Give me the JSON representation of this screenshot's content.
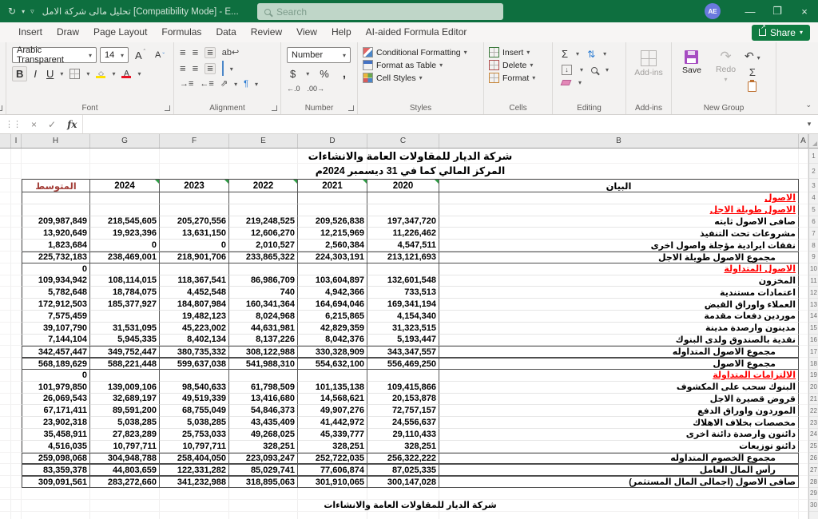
{
  "window": {
    "title": "تحليل مالى شركة الامل  [Compatibility Mode] - E...",
    "search_placeholder": "Search",
    "avatar": "AE",
    "minimize": "—",
    "restore": "❐",
    "close": "×"
  },
  "menubar": {
    "tabs": [
      "Insert",
      "Draw",
      "Page Layout",
      "Formulas",
      "Data",
      "Review",
      "View",
      "Help",
      "AI-aided Formula Editor"
    ],
    "share_label": "Share"
  },
  "ribbon": {
    "font_group": {
      "label": "Font",
      "font_name": "Arabic Transparent",
      "font_size": "14",
      "bold": "B",
      "italic": "I",
      "underline": "U"
    },
    "alignment_group": {
      "label": "Alignment"
    },
    "number_group": {
      "label": "Number",
      "format": "Number",
      "currency": "$",
      "percent": "%",
      "comma": ",",
      "inc_decimal": "←.0",
      "dec_decimal": ".00→"
    },
    "styles_group": {
      "label": "Styles",
      "items": [
        "Conditional Formatting",
        "Format as Table",
        "Cell Styles"
      ]
    },
    "cells_group": {
      "label": "Cells",
      "items": [
        "Insert",
        "Delete",
        "Format"
      ]
    },
    "editing_group": {
      "label": "Editing"
    },
    "addins_group": {
      "label": "Add-ins",
      "button": "Add-ins"
    },
    "new_group": {
      "label": "New Group",
      "save": "Save",
      "redo": "Redo"
    }
  },
  "formula_bar": {
    "cancel": "×",
    "enter": "✓",
    "fx": "fx",
    "value": ""
  },
  "sheet": {
    "columns": [
      "",
      "I",
      "H",
      "G",
      "F",
      "E",
      "D",
      "C",
      "B",
      "A"
    ],
    "title1": "شركة الديار للمقاولات العامة والانشاءات",
    "title2": "المركز المالي كما في 31 ديسمبر 2024م",
    "footer": "شركة الديار للمقاولات العامة والانشاءات",
    "header": {
      "avg": "المتوسط",
      "years": [
        "2024",
        "2023",
        "2022",
        "2021",
        "2020"
      ],
      "label": "البيان"
    },
    "rows": [
      {
        "label": "الاصول",
        "section": true,
        "values": [
          "",
          "",
          "",
          "",
          "",
          ""
        ]
      },
      {
        "label": "الاصول طويلة الاجل",
        "section": true,
        "values": [
          "",
          "",
          "",
          "",
          "",
          ""
        ]
      },
      {
        "label": "صافى الاصول ثابته",
        "values": [
          "209,987,849",
          "218,545,605",
          "205,270,556",
          "219,248,525",
          "209,526,838",
          "197,347,720"
        ]
      },
      {
        "label": "مشروعات تحت التنفيذ",
        "values": [
          "13,920,649",
          "19,923,396",
          "13,631,150",
          "12,606,270",
          "12,215,969",
          "11,226,462"
        ]
      },
      {
        "label": "نفقات ايرادية مؤجلة واصول اخرى",
        "values": [
          "1,823,684",
          "0",
          "0",
          "2,010,527",
          "2,560,384",
          "4,547,511"
        ]
      },
      {
        "label": "مجموع الاصول طويلة الاجل",
        "total": true,
        "indent": true,
        "values": [
          "225,732,183",
          "238,469,001",
          "218,901,706",
          "233,865,322",
          "224,303,191",
          "213,121,693"
        ]
      },
      {
        "label": "الاصول المتداولة",
        "section": true,
        "values": [
          "0",
          "",
          "",
          "",
          "",
          ""
        ]
      },
      {
        "label": "المخزون",
        "values": [
          "109,934,942",
          "108,114,015",
          "118,367,541",
          "86,986,709",
          "103,604,897",
          "132,601,548"
        ]
      },
      {
        "label": "اعتمادات مستندية",
        "values": [
          "5,782,648",
          "18,784,075",
          "4,452,548",
          "740",
          "4,942,366",
          "733,513"
        ]
      },
      {
        "label": "العملاء واوراق القبض",
        "values": [
          "172,912,503",
          "185,377,927",
          "184,807,984",
          "160,341,364",
          "164,694,046",
          "169,341,194"
        ]
      },
      {
        "label": "موردين دفعات مقدمة",
        "values": [
          "7,575,459",
          "",
          "19,482,123",
          "8,024,968",
          "6,215,865",
          "4,154,340"
        ]
      },
      {
        "label": "مدينون وارصدة مدينة",
        "values": [
          "39,107,790",
          "31,531,095",
          "45,223,002",
          "44,631,981",
          "42,829,359",
          "31,323,515"
        ]
      },
      {
        "label": "نقدية بالصندوق ولدى البنوك",
        "values": [
          "7,144,104",
          "5,945,335",
          "8,402,134",
          "8,137,226",
          "8,042,376",
          "5,193,447"
        ]
      },
      {
        "label": "مجموع الاصول المتداوله",
        "total": true,
        "indent": true,
        "values": [
          "342,457,447",
          "349,752,447",
          "380,735,332",
          "308,122,988",
          "330,328,909",
          "343,347,557"
        ]
      },
      {
        "label": "مجموع الاصول",
        "total": true,
        "indent": true,
        "values": [
          "568,189,629",
          "588,221,448",
          "599,637,038",
          "541,988,310",
          "554,632,100",
          "556,469,250"
        ]
      },
      {
        "label": "الالتزامات المتداولة",
        "section": true,
        "values": [
          "0",
          "",
          "",
          "",
          "",
          ""
        ]
      },
      {
        "label": "البنوك سحب على المكشوف",
        "values": [
          "101,979,850",
          "139,009,106",
          "98,540,633",
          "61,798,509",
          "101,135,138",
          "109,415,866"
        ]
      },
      {
        "label": "قروض قصيرة الاجل",
        "values": [
          "26,069,543",
          "32,689,197",
          "49,519,339",
          "13,416,680",
          "14,568,621",
          "20,153,878"
        ]
      },
      {
        "label": "الموردون واوراق الدفع",
        "values": [
          "67,171,411",
          "89,591,200",
          "68,755,049",
          "54,846,373",
          "49,907,276",
          "72,757,157"
        ]
      },
      {
        "label": "مخصصات بخلاف الاهلاك",
        "values": [
          "23,902,318",
          "5,038,285",
          "5,038,285",
          "43,435,409",
          "41,442,972",
          "24,556,637"
        ]
      },
      {
        "label": "دائنون وارصدة دائنة اخرى",
        "values": [
          "35,458,911",
          "27,823,289",
          "25,753,033",
          "49,268,025",
          "45,339,777",
          "29,110,433"
        ]
      },
      {
        "label": "دائنو توزيعات",
        "values": [
          "4,516,035",
          "10,797,711",
          "10,797,711",
          "328,251",
          "328,251",
          "328,251"
        ]
      },
      {
        "label": "مجموع الخصوم المتداوله",
        "total": true,
        "indent": true,
        "values": [
          "259,098,068",
          "304,948,788",
          "258,404,050",
          "223,093,247",
          "252,722,035",
          "256,322,222"
        ]
      },
      {
        "label": "رأس المال العامل",
        "total": true,
        "indent": true,
        "values": [
          "83,359,378",
          "44,803,659",
          "122,331,282",
          "85,029,741",
          "77,606,874",
          "87,025,335"
        ]
      },
      {
        "label": "صافى الاصول (اجمالى المال المستثمر)",
        "total": true,
        "values": [
          "309,091,561",
          "283,272,660",
          "341,232,988",
          "318,895,063",
          "301,910,065",
          "300,147,028"
        ]
      }
    ]
  }
}
